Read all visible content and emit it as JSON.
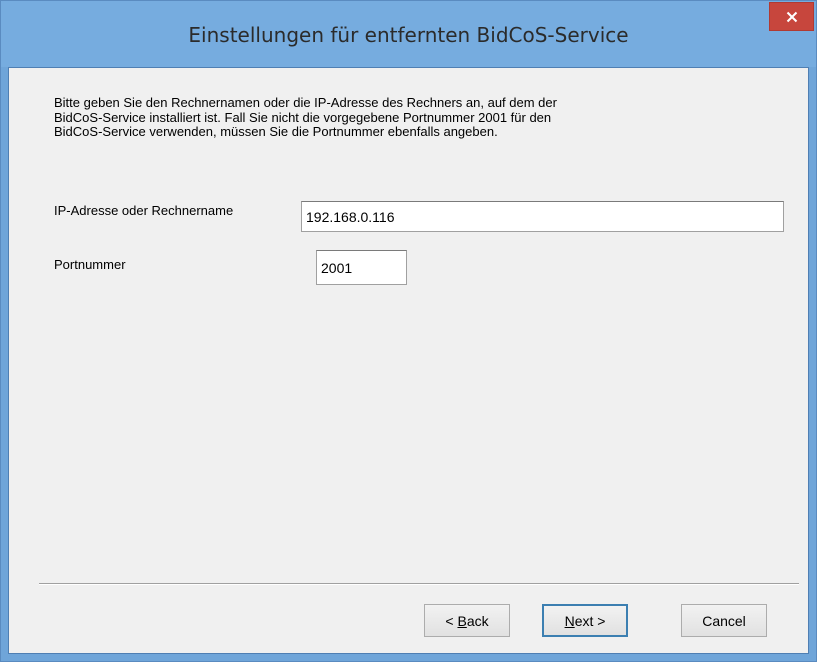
{
  "window": {
    "title": "Einstellungen für entfernten BidCoS-Service",
    "close_symbol": "×"
  },
  "content": {
    "description_lines": [
      "Bitte geben Sie den Rechnernamen oder die IP-Adresse des Rechners an, auf dem der",
      "BidCoS-Service installiert ist. Fall Sie nicht die vorgegebene Portnummer 2001 für den",
      "BidCoS-Service verwenden, müssen Sie die Portnummer ebenfalls angeben."
    ],
    "ip_label": "IP-Adresse oder Rechnername",
    "ip_value": "192.168.0.116",
    "port_label": "Portnummer",
    "port_value": "2001"
  },
  "buttons": {
    "back_prefix": "< ",
    "back_mnemonic": "B",
    "back_rest": "ack",
    "next_mnemonic": "N",
    "next_rest": "ext >",
    "cancel": "Cancel"
  },
  "colors": {
    "titlebar": "#76acdf",
    "close_button": "#c7463d",
    "dialog_background": "#f0f0f0",
    "default_button_border": "#3c7fb1"
  },
  "icons": {
    "close": "close-icon"
  }
}
